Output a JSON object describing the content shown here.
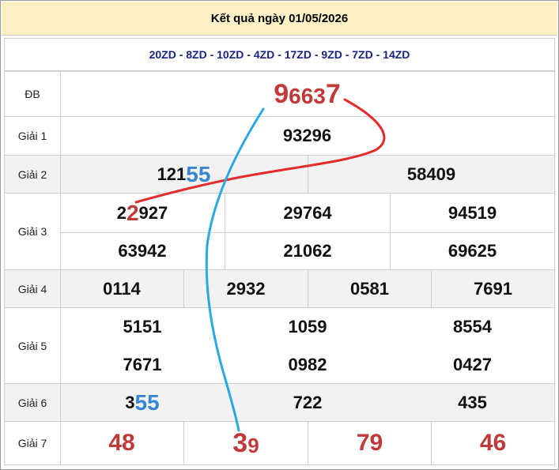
{
  "header": {
    "title": "Kết quả ngày 01/05/2026"
  },
  "subbar": {
    "codes": "20ZD - 8ZD - 10ZD - 4ZD - 17ZD - 9ZD - 7ZD - 14ZD"
  },
  "prizes": {
    "db": {
      "label": "ĐB",
      "first": "9",
      "middle": "663",
      "last": "7"
    },
    "g1": {
      "label": "Giải 1",
      "values": [
        "93296"
      ]
    },
    "g2": {
      "label": "Giải 2",
      "v1_head": "121",
      "v1_tail": "55",
      "v2": "58409"
    },
    "g3": {
      "label": "Giải 3",
      "v1_a": "2",
      "v1_b": "2",
      "v1_c": "927",
      "values": [
        "29764",
        "94519",
        "63942",
        "21062",
        "69625"
      ]
    },
    "g4": {
      "label": "Giải 4",
      "values": [
        "0114",
        "2932",
        "0581",
        "7691"
      ]
    },
    "g5": {
      "label": "Giải 5",
      "values": [
        "5151",
        "1059",
        "8554",
        "7671",
        "0982",
        "0427"
      ]
    },
    "g6": {
      "label": "Giải 6",
      "v1_head": "3",
      "v1_tail": "55",
      "values": [
        "722",
        "435"
      ]
    },
    "g7": {
      "label": "Giải 7",
      "v1": "48",
      "v2_a": "3",
      "v2_b": "9",
      "v3": "79",
      "v4": "46"
    }
  },
  "colors": {
    "red": "#c0393b",
    "blue": "#3a87d1",
    "header_bg": "#fdf0c4",
    "alt_row": "#f2f2f2"
  }
}
